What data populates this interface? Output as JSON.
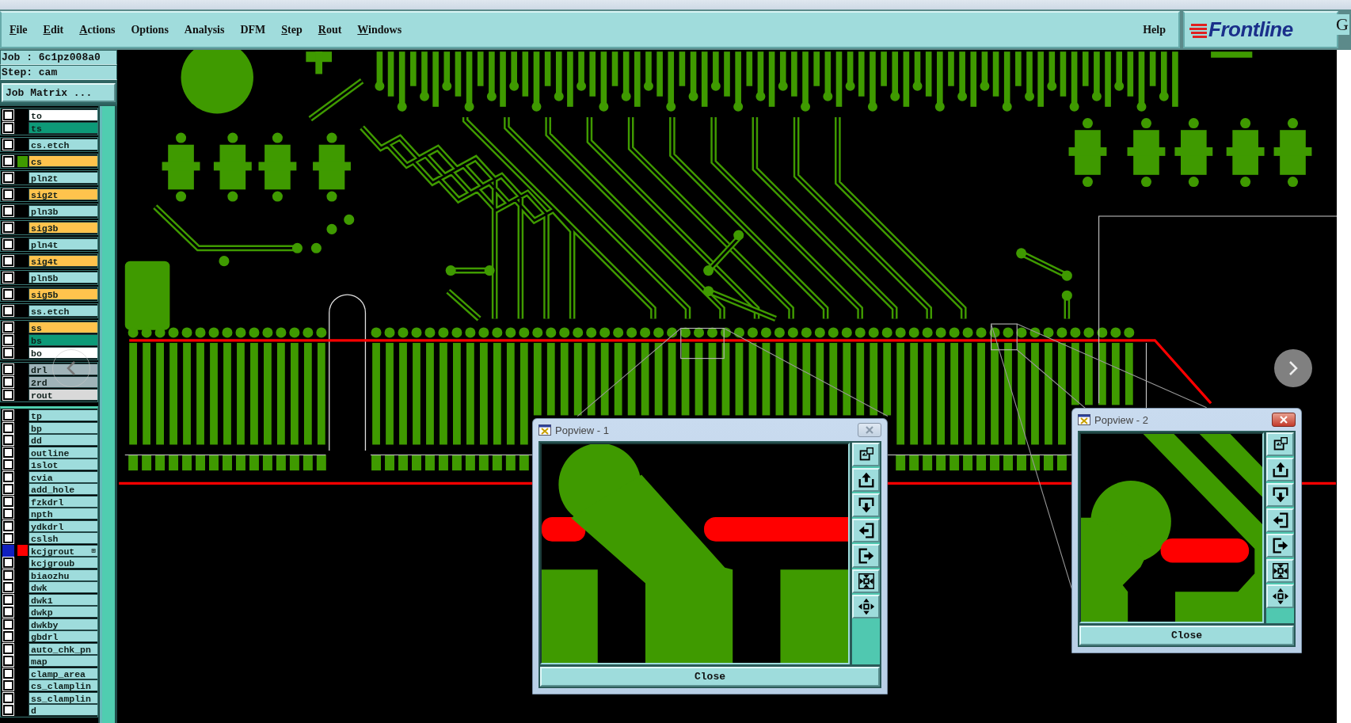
{
  "menu": {
    "items": [
      {
        "label": "File",
        "underline": true
      },
      {
        "label": "Edit",
        "underline": true
      },
      {
        "label": "Actions",
        "underline": true
      },
      {
        "label": "Options",
        "underline": false
      },
      {
        "label": "Analysis",
        "underline": false
      },
      {
        "label": "DFM",
        "underline": false
      },
      {
        "label": "Step",
        "underline": true
      },
      {
        "label": "Rout",
        "underline": true
      },
      {
        "label": "Windows",
        "underline": true
      }
    ],
    "help": "Help"
  },
  "logo": {
    "text": "Frontline",
    "cut_text": "G"
  },
  "job": {
    "job_line": "Job : 6c1pz008a0",
    "step_line": "Step: cam",
    "matrix_button": "Job Matrix ..."
  },
  "layer_groups": [
    {
      "layers": [
        {
          "name": "to",
          "color": "#ffffff",
          "selected": false
        },
        {
          "name": "ts",
          "color": "#0d9a78",
          "selected": false
        }
      ]
    },
    {
      "layers": [
        {
          "name": "cs.etch",
          "color": "#9edcdc",
          "selected": false
        }
      ]
    },
    {
      "layers": [
        {
          "name": "cs",
          "color": "#ffc34d",
          "selected": false,
          "swatch": {
            "color": "#3f9a00"
          }
        }
      ]
    },
    {
      "layers": [
        {
          "name": "pln2t",
          "color": "#9edcdc",
          "selected": false
        }
      ]
    },
    {
      "layers": [
        {
          "name": "sig2t",
          "color": "#ffc34d",
          "selected": false
        }
      ]
    },
    {
      "layers": [
        {
          "name": "pln3b",
          "color": "#9edcdc",
          "selected": false
        }
      ]
    },
    {
      "layers": [
        {
          "name": "sig3b",
          "color": "#ffc34d",
          "selected": false
        }
      ]
    },
    {
      "layers": [
        {
          "name": "pln4t",
          "color": "#9edcdc",
          "selected": false
        }
      ]
    },
    {
      "layers": [
        {
          "name": "sig4t",
          "color": "#ffc34d",
          "selected": false
        }
      ]
    },
    {
      "layers": [
        {
          "name": "pln5b",
          "color": "#9edcdc",
          "selected": false
        }
      ]
    },
    {
      "layers": [
        {
          "name": "sig5b",
          "color": "#ffc34d",
          "selected": false
        }
      ]
    },
    {
      "layers": [
        {
          "name": "ss.etch",
          "color": "#9edcdc",
          "selected": false
        }
      ]
    },
    {
      "layers": [
        {
          "name": "ss",
          "color": "#ffc34d",
          "selected": false
        },
        {
          "name": "bs",
          "color": "#0d9a78",
          "selected": false
        },
        {
          "name": "bo",
          "color": "#ffffff",
          "selected": false
        }
      ]
    },
    {
      "layers": [
        {
          "name": "drl",
          "color": "#9fb3b8",
          "selected": false
        },
        {
          "name": "2rd",
          "color": "#9fb3b8",
          "selected": false
        },
        {
          "name": "rout",
          "color": "#d9d9d9",
          "selected": false
        }
      ]
    },
    {
      "layers": [
        {
          "name": "tp",
          "color": "#9edcdc",
          "selected": false
        },
        {
          "name": "bp",
          "color": "#9edcdc",
          "selected": false
        },
        {
          "name": "dd",
          "color": "#9edcdc",
          "selected": false
        },
        {
          "name": "outline",
          "color": "#9edcdc",
          "selected": false
        },
        {
          "name": "1slot",
          "color": "#9edcdc",
          "selected": false
        },
        {
          "name": "cvia",
          "color": "#9edcdc",
          "selected": false
        },
        {
          "name": "add_hole",
          "color": "#9edcdc",
          "selected": false
        },
        {
          "name": "fzkdrl",
          "color": "#9edcdc",
          "selected": false
        },
        {
          "name": "npth",
          "color": "#9edcdc",
          "selected": false
        },
        {
          "name": "ydkdrl",
          "color": "#9edcdc",
          "selected": false
        },
        {
          "name": "cslsh",
          "color": "#9edcdc",
          "selected": false
        },
        {
          "name": "kcjgrout",
          "color": "#9edcdc",
          "selected": true,
          "swatch": {
            "color": "#ff0000"
          },
          "mark": "⊞"
        },
        {
          "name": "kcjgroub",
          "color": "#9edcdc",
          "selected": false
        },
        {
          "name": "biaozhu",
          "color": "#9edcdc",
          "selected": false
        },
        {
          "name": "dwk",
          "color": "#9edcdc",
          "selected": false
        },
        {
          "name": "dwk1",
          "color": "#9edcdc",
          "selected": false
        },
        {
          "name": "dwkp",
          "color": "#9edcdc",
          "selected": false
        },
        {
          "name": "dwkby",
          "color": "#9edcdc",
          "selected": false
        },
        {
          "name": "gbdrl",
          "color": "#9edcdc",
          "selected": false
        },
        {
          "name": "auto_chk_pn",
          "color": "#9edcdc",
          "selected": false
        },
        {
          "name": "map",
          "color": "#9edcdc",
          "selected": false
        },
        {
          "name": "clamp_area",
          "color": "#9edcdc",
          "selected": false
        },
        {
          "name": "cs_clamplin",
          "color": "#9edcdc",
          "selected": false
        },
        {
          "name": "ss_clamplin",
          "color": "#9edcdc",
          "selected": false
        },
        {
          "name": "d",
          "color": "#9edcdc",
          "selected": false
        }
      ]
    }
  ],
  "popviews": [
    {
      "title": "Popview - 1",
      "active": false,
      "close_button": "Close"
    },
    {
      "title": "Popview - 2",
      "active": true,
      "close_button": "Close"
    }
  ]
}
